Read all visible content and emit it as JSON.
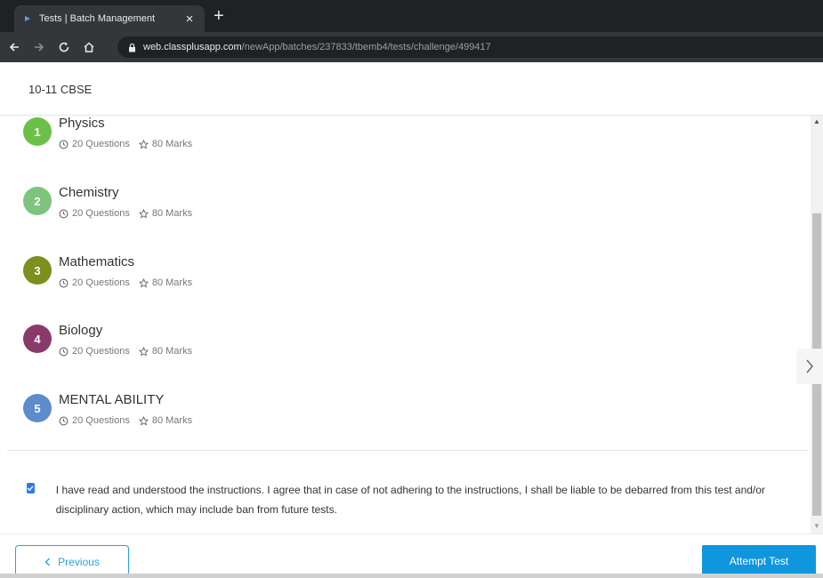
{
  "browser": {
    "tab_title": "Tests | Batch Management",
    "tab_close": "×",
    "new_tab": "+",
    "url_host": "web.classplusapp.com",
    "url_path": "/newApp/batches/237833/tbemb4/tests/challenge/499417"
  },
  "header": {
    "batch_name": "10-11 CBSE"
  },
  "subjects": [
    {
      "number": "1",
      "name": "Physics",
      "questions": "20 Questions",
      "marks": "80 Marks",
      "color": "#6cc04a"
    },
    {
      "number": "2",
      "name": "Chemistry",
      "questions": "20 Questions",
      "marks": "80 Marks",
      "color": "#7ec47d"
    },
    {
      "number": "3",
      "name": "Mathematics",
      "questions": "20 Questions",
      "marks": "80 Marks",
      "color": "#7c8f1f"
    },
    {
      "number": "4",
      "name": "Biology",
      "questions": "20 Questions",
      "marks": "80 Marks",
      "color": "#8a3a6a"
    },
    {
      "number": "5",
      "name": "MENTAL ABILITY",
      "questions": "20 Questions",
      "marks": "80 Marks",
      "color": "#5c8ccc"
    }
  ],
  "agreement": {
    "checked": true,
    "text": "I have read and understood the instructions. I agree that in case of not adhering to the instructions, I shall be liable to be debarred from this test and/or disciplinary action, which may include ban from future tests."
  },
  "footer": {
    "previous_label": "Previous",
    "attempt_label": "Attempt Test"
  },
  "icons": {
    "back": "arrow-left-icon",
    "forward": "arrow-right-icon",
    "reload": "reload-icon",
    "home": "home-icon",
    "lock": "lock-icon",
    "questions": "clock-icon",
    "marks": "star-icon",
    "next": "chevron-right-icon"
  }
}
